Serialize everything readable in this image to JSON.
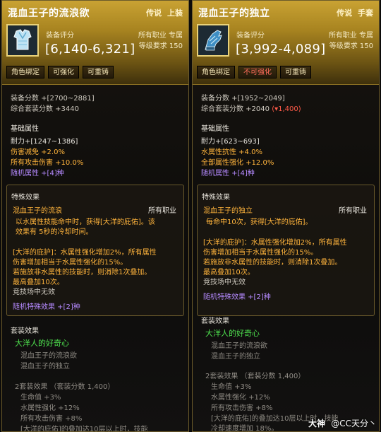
{
  "left": {
    "title": "混血王子的流浪欲",
    "tag1": "传说",
    "tag2": "上装",
    "equip_label": "装备评分",
    "score": "[6,140-6,321]",
    "jobs": "所有职业 专属",
    "level": "等级要求 150",
    "buttons": [
      "角色绑定",
      "可强化",
      "可重铸"
    ],
    "equip_score": "装备分数 +[2700~2881]",
    "set_score": "综合套装分数 +3440",
    "basic_attr": "基础属性",
    "stat1": "耐力+[1247~1386]",
    "stat2": "伤害减免 +2.0%",
    "stat3": "所有攻击伤害 +10.0%",
    "stat4": "随机属性 +[4]种",
    "special_title": "特殊效果",
    "effect_name": "混血王子的流浪",
    "effect_jobs": "所有职业",
    "e1": "以水属性技能命中时，获得[大洋的庇佑]。该",
    "e2": "效果有 5秒的冷却时间。",
    "e3": "[大洋的庇护]：水属性强化增加2%，所有属性",
    "e4": "伤害增加相当于水属性强化的15%。",
    "e5": "若施放非水属性的技能时，则消除1次叠加。",
    "e6": "最高叠加10次。",
    "e7": "竞技场中无效",
    "random_special": "随机特殊效果 +[2]种",
    "set_effect": "套装效果",
    "set_name": "大洋人的好奇心",
    "set_item1": "混血王子的流浪欲",
    "set_item2": "混血王子的独立",
    "s2": "2套装效果 （套装分数 1,400）",
    "s3": "生命值 +3%",
    "s4": "水属性强化 +12%",
    "s5": "所有攻击伤害 +8%",
    "s6": "[大洋的庇佑]的叠加达10层以上时，技能"
  },
  "right": {
    "title": "混血王子的独立",
    "tag1": "传说",
    "tag2": "手套",
    "equip_label": "装备评分",
    "score": "[3,992-4,089]",
    "jobs": "所有职业 专属",
    "level": "等级要求 150",
    "buttons": [
      "角色绑定",
      "不可强化",
      "可重铸"
    ],
    "equip_score": "装备分数 +[1952~2049]",
    "set_score": "综合套装分数 +2040",
    "set_score_diff": "(▾1,400)",
    "basic_attr": "基础属性",
    "stat1": "耐力+[623~693]",
    "stat2": "水属性抗性 +4.0%",
    "stat3": "全部属性强化 +12.0%",
    "stat4": "随机属性 +[4]种",
    "special_title": "特殊效果",
    "effect_name": "混血王子的独立",
    "effect_jobs": "所有职业",
    "e1": "每命中10次，获得[大洋的庇佑]。",
    "e3": "[大洋的庇护]：水属性强化增加2%，所有属性",
    "e4": "伤害增加相当于水属性强化的15%。",
    "e5": "若施放非水属性的技能时，则消除1次叠加。",
    "e6": "最高叠加10次。",
    "e7": "竞技场中无效",
    "random_special": "随机特殊效果 +[2]种",
    "set_effect": "套装效果",
    "set_name": "大洋人的好奇心",
    "set_item1": "混血王子的流浪欲",
    "set_item2": "混血王子的独立",
    "s2": "2套装效果 （套装分数 1,400）",
    "s3": "生命值 +3%",
    "s4": "水属性强化 +12%",
    "s5": "所有攻击伤害 +8%",
    "s6": "[大洋的庇佑]的叠加达10层以上时，技能",
    "s7": "冷却速度增加 18%。"
  },
  "watermark": {
    "brand": "大神",
    "user": "@CC天分丶"
  },
  "colors": {
    "gold_header": "#c9a233",
    "orange_stat": "#ffb43c",
    "purple_stat": "#b58aff",
    "set_green": "#4ee04e",
    "red_warn": "#ff5a48"
  }
}
